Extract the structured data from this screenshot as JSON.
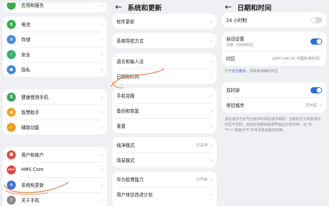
{
  "left_panel": {
    "title": "设置",
    "top_item": "应用和服务",
    "group1": [
      {
        "label": "电池",
        "icon": "battery-icon",
        "color": "#2fb344"
      },
      {
        "label": "存储",
        "icon": "storage-icon",
        "color": "#3f8de0"
      },
      {
        "label": "安全",
        "icon": "shield-icon",
        "color": "#33b06b"
      },
      {
        "label": "隐私",
        "icon": "privacy-icon",
        "color": "#3a86ea"
      }
    ],
    "group2": [
      {
        "label": "健康使用手机",
        "icon": "hourglass-icon",
        "color": "#37a85c"
      },
      {
        "label": "智慧助手",
        "icon": "assistant-icon",
        "color": "#f3a51c"
      },
      {
        "label": "辅助功能",
        "icon": "accessibility-icon",
        "color": "#f59b1a"
      }
    ],
    "group3": [
      {
        "label": "用户和帐户",
        "icon": "user-icon",
        "color": "#e8463a"
      },
      {
        "label": "HMS Core",
        "icon": "hms-core-icon",
        "color": "#e0443a",
        "mark": "HMS"
      },
      {
        "label": "系统和更新",
        "icon": "system-update-icon",
        "color": "#3a6fe0"
      },
      {
        "label": "关于手机",
        "icon": "about-phone-icon",
        "color": "#8a8a8a"
      }
    ]
  },
  "middle_panel": {
    "title": "系统和更新",
    "group1": [
      "软件更新"
    ],
    "group2": [
      "系统导航方式"
    ],
    "group3": [
      "语言和输入法",
      "日期和时间"
    ],
    "group4": [
      "手机克隆",
      "备份和恢复",
      "重置"
    ],
    "group5": [
      {
        "label": "纯净模式",
        "value": "已关闭"
      },
      {
        "label": "简易模式",
        "value": ""
      }
    ],
    "group6": [
      {
        "label": "华为智慧能力",
        "value": "已开启"
      },
      {
        "label": "用户体验改进计划",
        "value": ""
      }
    ]
  },
  "right_panel": {
    "title": "日期和时间",
    "format_24h_label": "24 小时制",
    "format_24h_on": false,
    "auto_set_label": "自动设置",
    "auto_set_sub": "日期、时间和时区",
    "auto_set_on": true,
    "timezone_label": "时区",
    "timezone_value": "GMT+08:00 中国标准时间",
    "location_note_prefix": "打开",
    "location_note_link": "定位服务",
    "location_note_suffix": "，获取最准确的时区",
    "dual_clock_label": "双时钟",
    "dual_clock_on": true,
    "resident_city_label": "常驻城市",
    "resident_city_value": "安州区",
    "dual_clock_note": "常驻城市与天气应用中的常驻城市相同。当前时区与常驻城市时区不同时，自动在锁屏和锁屏界面显示双时钟。在\"天气\">\"桌面天气\"中可设置桌面双时钟。"
  },
  "colors": {
    "accent": "#2d6ce0",
    "annotation": "#f08a4b"
  }
}
